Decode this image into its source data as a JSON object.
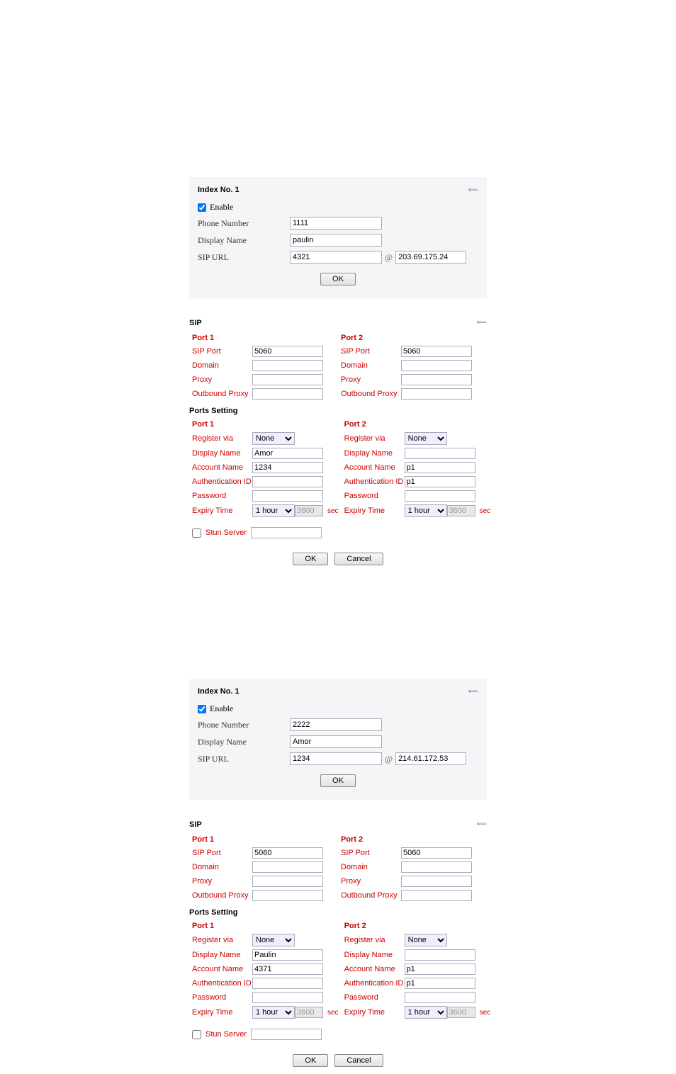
{
  "block1": {
    "index": {
      "title": "Index No. 1",
      "enable_label": "Enable",
      "phone_label": "Phone Number",
      "phone_value": "1111",
      "display_label": "Display Name",
      "display_value": "paulin",
      "sip_url_label": "SIP URL",
      "sip_url_value": "4321",
      "sip_ip": "203.69.175.24",
      "at": "@",
      "ok": "OK"
    },
    "sip": {
      "title": "SIP",
      "port1_hdr": "Port 1",
      "port2_hdr": "Port 2",
      "sip_port_label": "SIP Port",
      "p1_sip_port": "5060",
      "p2_sip_port": "5060",
      "domain_label": "Domain",
      "proxy_label": "Proxy",
      "outbound_label": "Outbound Proxy"
    },
    "ports": {
      "title": "Ports Setting",
      "port1_hdr": "Port 1",
      "port2_hdr": "Port 2",
      "register_label": "Register via",
      "p1_register": "None",
      "p2_register": "None",
      "display_label": "Display Name",
      "p1_display": "Amor",
      "account_label": "Account Name",
      "p1_account": "1234",
      "p2_account": "p1",
      "auth_label": "Authentication ID",
      "p2_auth": "p1",
      "password_label": "Password",
      "expiry_label": "Expiry Time",
      "expiry_sel": "1 hour",
      "expiry_val": "3600",
      "sec": "sec",
      "stun_label": "Stun Server",
      "ok": "OK",
      "cancel": "Cancel"
    }
  },
  "block2": {
    "index": {
      "title": "Index No. 1",
      "enable_label": "Enable",
      "phone_label": "Phone Number",
      "phone_value": "2222",
      "display_label": "Display Name",
      "display_value": "Amor",
      "sip_url_label": "SIP URL",
      "sip_url_value": "1234",
      "sip_ip": "214.61.172.53",
      "at": "@",
      "ok": "OK"
    },
    "sip": {
      "title": "SIP",
      "port1_hdr": "Port 1",
      "port2_hdr": "Port 2",
      "sip_port_label": "SIP Port",
      "p1_sip_port": "5060",
      "p2_sip_port": "5060",
      "domain_label": "Domain",
      "proxy_label": "Proxy",
      "outbound_label": "Outbound Proxy"
    },
    "ports": {
      "title": "Ports Setting",
      "port1_hdr": "Port 1",
      "port2_hdr": "Port 2",
      "register_label": "Register via",
      "p1_register": "None",
      "p2_register": "None",
      "display_label": "Display Name",
      "p1_display": "Paulin",
      "account_label": "Account Name",
      "p1_account": "4371",
      "p2_account": "p1",
      "auth_label": "Authentication ID",
      "p2_auth": "p1",
      "password_label": "Password",
      "expiry_label": "Expiry Time",
      "expiry_sel": "1 hour",
      "expiry_val": "3600",
      "sec": "sec",
      "stun_label": "Stun Server",
      "ok": "OK",
      "cancel": "Cancel"
    }
  }
}
